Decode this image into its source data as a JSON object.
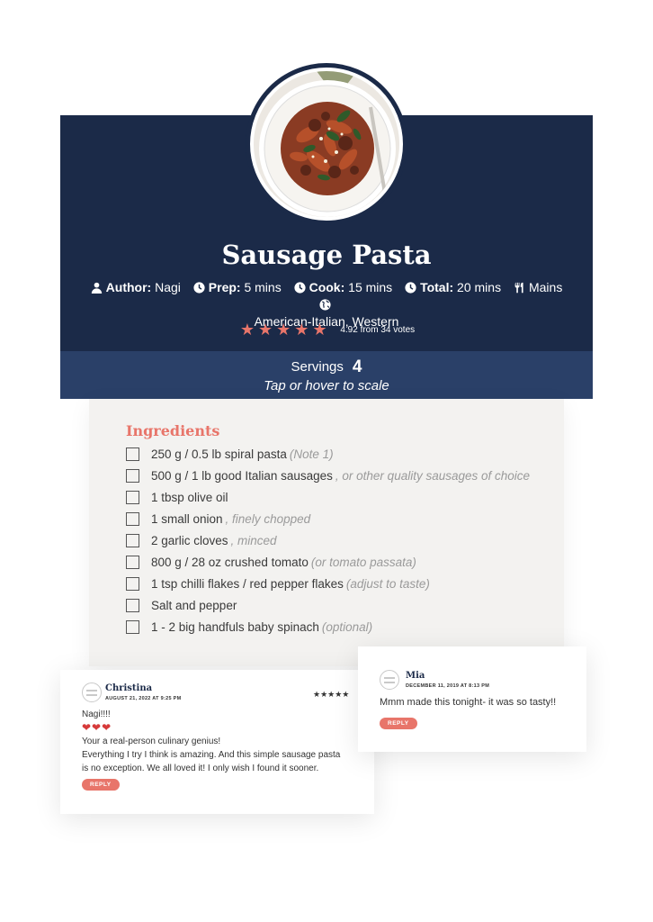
{
  "recipe": {
    "title": "Sausage Pasta",
    "meta": {
      "author_label": "Author:",
      "author": "Nagi",
      "prep_label": "Prep:",
      "prep": "5 mins",
      "cook_label": "Cook:",
      "cook": "15 mins",
      "total_label": "Total:",
      "total": "20 mins",
      "course": "Mains",
      "cuisine": "American-Italian, Western"
    },
    "rating": {
      "stars": 5,
      "text": "4.92 from 34 votes"
    },
    "servings": {
      "label": "Servings",
      "value": "4",
      "note": "Tap or hover to scale"
    }
  },
  "ingredients": {
    "heading": "Ingredients",
    "items": [
      {
        "text": "250 g / 0.5 lb spiral pasta",
        "note": "(Note 1)"
      },
      {
        "text": "500 g / 1 lb good Italian sausages",
        "note": ", or other quality sausages of choice"
      },
      {
        "text": "1 tbsp olive oil",
        "note": ""
      },
      {
        "text": "1 small onion",
        "note": ", finely chopped"
      },
      {
        "text": "2 garlic cloves",
        "note": ", minced"
      },
      {
        "text": "800 g / 28 oz crushed tomato",
        "note": "(or tomato passata)"
      },
      {
        "text": "1 tsp chilli flakes / red pepper flakes",
        "note": "(adjust to taste)"
      },
      {
        "text": "Salt and pepper",
        "note": ""
      },
      {
        "text": "1 - 2 big handfuls baby spinach",
        "note": "(optional)"
      }
    ]
  },
  "comments": [
    {
      "name": "Christina",
      "date": "AUGUST 21, 2022 AT 9:25 PM",
      "stars": "★★★★★",
      "lines": [
        "Nagi!!!!",
        "❤❤❤",
        "Your a real-person culinary genius!",
        "Everything I try I think is amazing. And this simple sausage pasta",
        "is no exception. We all loved it! I only wish I found it sooner."
      ],
      "reply": "REPLY"
    },
    {
      "name": "Mia",
      "date": "DECEMBER 11, 2019 AT 8:13 PM",
      "lines": [
        "Mmm made this tonight- it was so tasty!!"
      ],
      "reply": "REPLY"
    }
  ],
  "colors": {
    "header_bg": "#1b2a48",
    "servings_bg": "#2a4068",
    "accent": "#e8756a",
    "card_bg": "#f3f2f0"
  }
}
